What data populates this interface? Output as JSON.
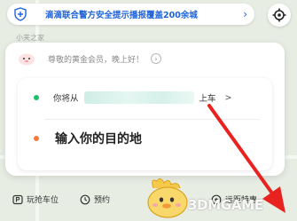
{
  "map": {
    "label": "小夹之家"
  },
  "banner": {
    "text": "滴滴联合警方安全提示播报覆盖200余城",
    "arrow": "›",
    "icon": "shield-icon"
  },
  "locate": {
    "icon": "locate-icon"
  },
  "card": {
    "greeting": "尊敬的黄金会员，晚上好！",
    "greeting_arrow": "›",
    "pickup": {
      "prefix": "你将从",
      "suffix": "上车",
      "arrow": ">"
    },
    "destination": {
      "placeholder": "输入你的目的地"
    }
  },
  "bottom_nav": {
    "items": [
      {
        "label": "玩抢车位",
        "icon": "parking-icon"
      },
      {
        "label": "预约",
        "icon": "clock-icon"
      },
      {
        "label": "远距特惠",
        "icon": "discount-icon"
      }
    ]
  },
  "watermark": {
    "text": "3DMGAME"
  },
  "colors": {
    "accent_blue": "#1f63d8",
    "pickup_dot": "#1fbf6a",
    "destination_dot": "#f47a3c",
    "annotation_arrow": "#e8231f"
  }
}
